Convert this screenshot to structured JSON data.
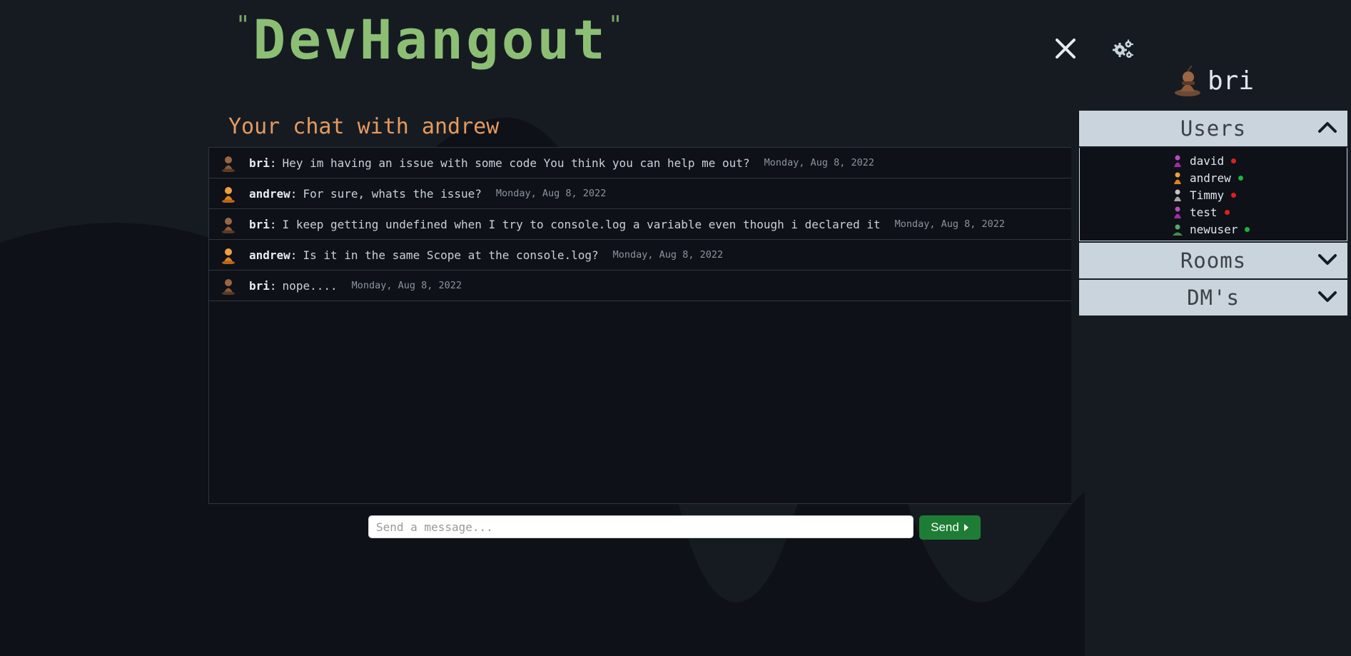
{
  "app": {
    "logo_text": "DevHangout",
    "logo_quote_open": "\"",
    "logo_quote_close": "\""
  },
  "header": {
    "close_icon": "close-icon",
    "settings_icon": "gears-icon",
    "current_user": {
      "name": "bri",
      "avatar_icon": "pawn-avatar-icon"
    }
  },
  "chat": {
    "title": "Your chat with andrew",
    "messages": [
      {
        "author": "bri",
        "text": "Hey im having an issue with some code You think you can help me out?",
        "time": "Monday, Aug 8, 2022",
        "avatar_color": "#8a5a3a"
      },
      {
        "author": "andrew",
        "text": "For sure, whats the issue?",
        "time": "Monday, Aug 8, 2022",
        "avatar_color": "#e0811f"
      },
      {
        "author": "bri",
        "text": "I keep getting undefined when I try to console.log a variable even though i declared it",
        "time": "Monday, Aug 8, 2022",
        "avatar_color": "#8a5a3a"
      },
      {
        "author": "andrew",
        "text": "Is it in the same Scope at the console.log?",
        "time": "Monday, Aug 8, 2022",
        "avatar_color": "#e0811f"
      },
      {
        "author": "bri",
        "text": "nope....",
        "time": "Monday, Aug 8, 2022",
        "avatar_color": "#8a5a3a"
      }
    ],
    "separator": ":"
  },
  "composer": {
    "placeholder": "Send a message...",
    "value": "",
    "send_label": "Send",
    "send_icon": "caret-right-icon"
  },
  "sidebar": {
    "users": {
      "label": "Users",
      "expanded": true,
      "items": [
        {
          "name": "david",
          "online": false,
          "avatar_color": "#9b2fa6"
        },
        {
          "name": "andrew",
          "online": true,
          "avatar_color": "#e0811f"
        },
        {
          "name": "Timmy",
          "online": false,
          "avatar_color": "#a7a7a7"
        },
        {
          "name": "test",
          "online": false,
          "avatar_color": "#9b2fa6"
        },
        {
          "name": "newuser",
          "online": true,
          "avatar_color": "#3f8f4c"
        }
      ]
    },
    "rooms": {
      "label": "Rooms",
      "expanded": false
    },
    "dms": {
      "label": "DM's",
      "expanded": false
    }
  },
  "colors": {
    "background": "#161b22",
    "logo": "#8cbf74",
    "chat_title": "#e59a5e",
    "panel_header": "#c9d4dc",
    "send_button": "#1e7d35",
    "online": "#1db33c",
    "offline": "#e0201c"
  }
}
